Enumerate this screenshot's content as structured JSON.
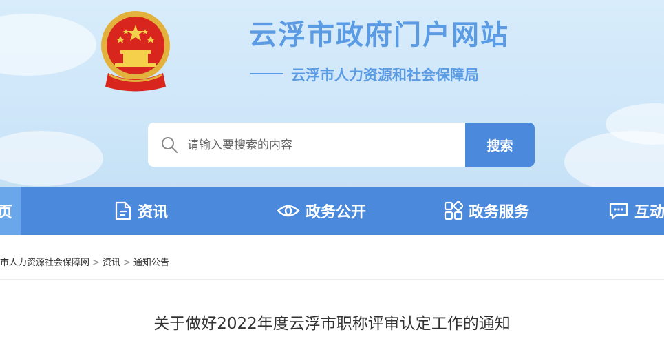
{
  "header": {
    "site_title": "云浮市政府门户网站",
    "sub_title": "云浮市人力资源和社会保障局"
  },
  "search": {
    "placeholder": "请输入要搜索的内容",
    "button_label": "搜索"
  },
  "nav": {
    "items": [
      {
        "label": "页",
        "icon": "none"
      },
      {
        "label": "资讯",
        "icon": "document-icon"
      },
      {
        "label": "政务公开",
        "icon": "eye-icon"
      },
      {
        "label": "政务服务",
        "icon": "grid-icon"
      },
      {
        "label": "互动",
        "icon": "chat-icon"
      }
    ]
  },
  "breadcrumb": {
    "items": [
      "市人力资源社会保障网",
      "资讯",
      "通知公告"
    ],
    "separator": ">"
  },
  "article": {
    "title": "关于做好2022年度云浮市职称评审认定工作的通知"
  },
  "colors": {
    "brand_blue": "#4a89dc",
    "title_blue": "#5b9be3",
    "header_bg": "#d8ecfb"
  }
}
